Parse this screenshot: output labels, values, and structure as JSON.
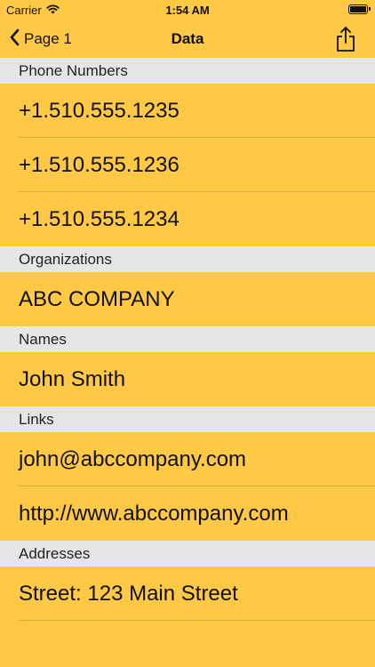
{
  "status_bar": {
    "carrier": "Carrier",
    "time": "1:54 AM"
  },
  "nav": {
    "back_label": "Page 1",
    "title": "Data"
  },
  "sections": {
    "phones": {
      "header": "Phone Numbers",
      "items": [
        "+1.510.555.1235",
        "+1.510.555.1236",
        "+1.510.555.1234"
      ]
    },
    "organizations": {
      "header": "Organizations",
      "items": [
        "ABC COMPANY"
      ]
    },
    "names": {
      "header": "Names",
      "items": [
        "John Smith"
      ]
    },
    "links": {
      "header": "Links",
      "items": [
        "john@abccompany.com",
        "http://www.abccompany.com"
      ]
    },
    "addresses": {
      "header": "Addresses",
      "items": [
        "Street: 123 Main Street"
      ]
    }
  },
  "colors": {
    "background": "#ffc845",
    "section_header": "#e6e6e6",
    "separator": "#d4ae3f"
  }
}
